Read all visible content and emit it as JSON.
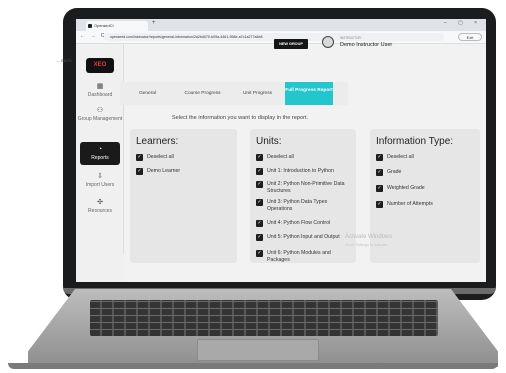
{
  "browser": {
    "tab_title": "OperaedCI",
    "new_tab": "+",
    "window_controls": "– ▢ ×",
    "nav_buttons": "← → C",
    "url": "operaeed.com/instructor/reports/general-information/2a2bd070-b09a-4461-958e-a7c1a277a5e8",
    "exit_label": "Exit"
  },
  "sidebar": {
    "logo": "XEO",
    "items": [
      {
        "label": "Dashboard",
        "icon": "dashboard-icon"
      },
      {
        "label": "Group Management",
        "icon": "group-icon"
      },
      {
        "label": "Reports",
        "icon": "reports-icon",
        "active": true
      },
      {
        "label": "Import Users",
        "icon": "import-icon"
      },
      {
        "label": "Resources",
        "icon": "resources-icon"
      }
    ]
  },
  "header": {
    "new_group": "NEW GROUP",
    "role": "INSTRUCTOR",
    "user": "Demo Instructor User"
  },
  "back_label": "BACK",
  "tabs": [
    "General",
    "Course Progress",
    "Unit Progress",
    "Full Progress Report"
  ],
  "instruction": "Select the information you want to display in the report.",
  "learners": {
    "title": "Learners:",
    "options": [
      "Deselect all",
      "Demo Learner"
    ]
  },
  "units": {
    "title": "Units:",
    "options": [
      "Deselect all",
      "Unit 1: Introduction to Python",
      "Unit 2: Python Non-Primitive Data Structures",
      "Unit 3: Python Data Types Operations",
      "Unit 4: Python Flow Control",
      "Unit 5: Python Input and Output",
      "Unit 6: Python Modules and Packages"
    ]
  },
  "info": {
    "title": "Information Type:",
    "options": [
      "Deselect all",
      "Grade",
      "Weighted Grade",
      "Number of Attempts"
    ]
  },
  "watermark": {
    "line1": "Activate Windows",
    "line2": "Go to Settings to activate"
  },
  "colors": {
    "accent": "#23c6cc",
    "dark": "#1a1a1a"
  }
}
